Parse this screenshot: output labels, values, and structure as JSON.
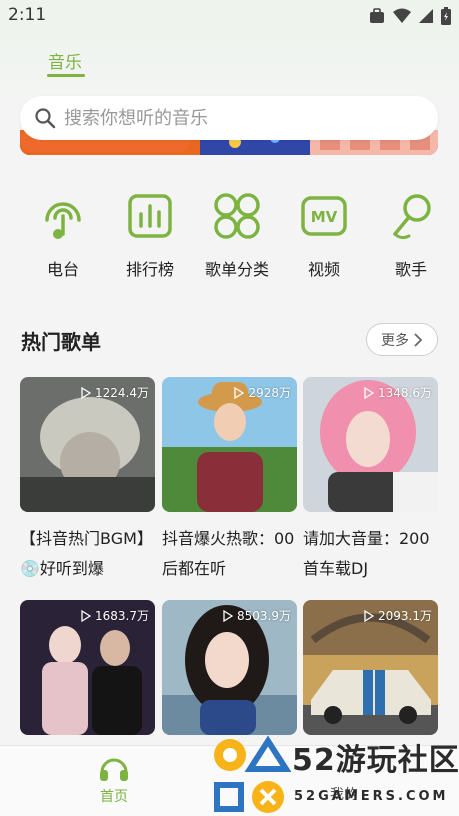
{
  "status": {
    "time": "2:11"
  },
  "header": {
    "tab_label": "音乐"
  },
  "search": {
    "placeholder": "搜索你想听的音乐"
  },
  "nav": {
    "items": [
      {
        "label": "电台",
        "icon": "radio-icon"
      },
      {
        "label": "排行榜",
        "icon": "chart-icon"
      },
      {
        "label": "歌单分类",
        "icon": "category-icon"
      },
      {
        "label": "视频",
        "icon": "mv-icon"
      },
      {
        "label": "歌手",
        "icon": "microphone-icon"
      }
    ]
  },
  "hot": {
    "title": "热门歌单",
    "more_label": "更多",
    "playlists": [
      {
        "title": "【抖音热门BGM】💿好听到爆",
        "plays": "1224.4万"
      },
      {
        "title": "抖音爆火热歌：00后都在听",
        "plays": "2928万"
      },
      {
        "title": "请加大音量：200首车载DJ",
        "plays": "1348.6万"
      },
      {
        "title": "",
        "plays": "1683.7万"
      },
      {
        "title": "",
        "plays": "8503.9万"
      },
      {
        "title": "",
        "plays": "2093.1万"
      }
    ]
  },
  "bottom_nav": {
    "home_label": "首页",
    "mine_label": "我的"
  },
  "watermark": {
    "brand": "52游玩社区",
    "domain": "52GAMERS.COM"
  },
  "colors": {
    "accent": "#7cb341",
    "background": "#f3f4f3"
  }
}
